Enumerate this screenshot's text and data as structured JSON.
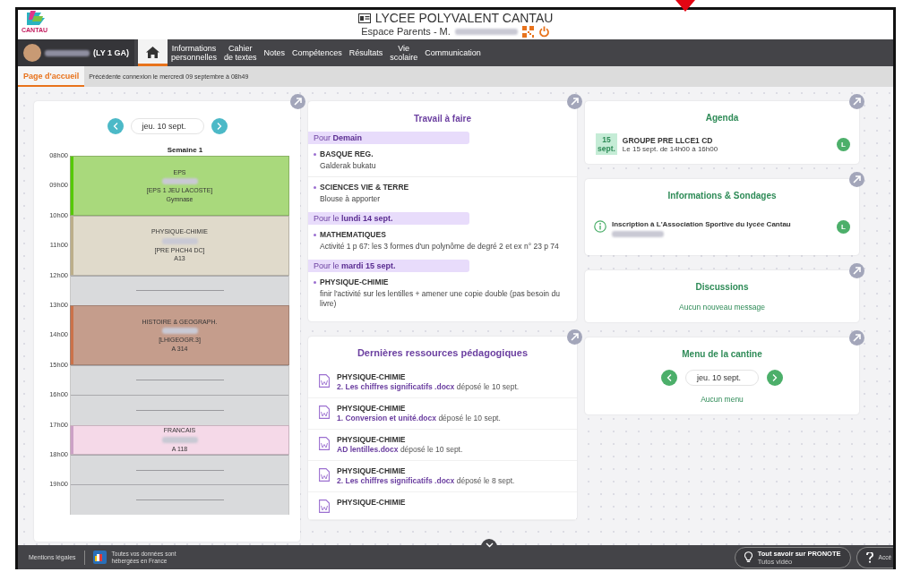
{
  "header": {
    "logo_text": "CANTAU",
    "school": "LYCEE POLYVALENT CANTAU",
    "space": "Espace Parents - M."
  },
  "nav": {
    "student_class": "(LY 1 GA)",
    "items": [
      {
        "kind": "home",
        "selected": true
      },
      {
        "kind": "text",
        "label": "Informations\npersonnelles",
        "selected": false
      },
      {
        "kind": "text",
        "label": "Cahier\nde textes",
        "selected": false
      },
      {
        "kind": "text",
        "label": "Notes",
        "selected": false
      },
      {
        "kind": "text",
        "label": "Compétences",
        "selected": false
      },
      {
        "kind": "text",
        "label": "Résultats",
        "selected": false
      },
      {
        "kind": "text",
        "label": "Vie\nscolaire",
        "selected": false
      },
      {
        "kind": "text",
        "label": "Communication",
        "selected": false
      }
    ]
  },
  "subbar": {
    "tabs": [
      {
        "label": "Page d'accueil",
        "selected": true
      }
    ],
    "last_login": "Précédente connexion le mercredi 09 septembre à 08h49"
  },
  "timetable": {
    "date": "jeu. 10 sept.",
    "week": "Semaine 1",
    "slots": [
      {
        "kind": "lesson",
        "hours": [
          "08h00",
          "09h00"
        ],
        "color": "#a9d97c",
        "subject": "EPS",
        "group": "[EPS 1 JEU LACOSTE]",
        "room": "Gymnase"
      },
      {
        "kind": "lesson",
        "hours": [
          "10h00",
          "11h00"
        ],
        "color": "#e0dacb",
        "subject": "PHYSIQUE-CHIMIE",
        "group": "[PRE PHCH4 DC]",
        "room": "A13"
      },
      {
        "kind": "free",
        "hours": [
          "12h00"
        ]
      },
      {
        "kind": "lesson",
        "hours": [
          "13h00",
          "14h00"
        ],
        "color": "#c59d8c",
        "subject": "HISTOIRE & GEOGRAPH.",
        "group": "[LHIGEOGR.3]",
        "room": "A 314"
      },
      {
        "kind": "free",
        "hours": [
          "15h00",
          "16h00"
        ]
      },
      {
        "kind": "lesson",
        "hours": [
          "17h00"
        ],
        "color": "#f5d9e8",
        "subject": "FRANCAIS",
        "room": "A 118"
      },
      {
        "kind": "free",
        "hours": [
          "18h00",
          "19h00"
        ]
      }
    ]
  },
  "homework": {
    "title": "Travail à faire",
    "groups": [
      {
        "heading": "Pour **Demain**",
        "items": [
          {
            "subject": "BASQUE REG.",
            "text": "Galderak bukatu"
          },
          {
            "subject": "SCIENCES VIE & TERRE",
            "text": "Blouse à apporter"
          }
        ]
      },
      {
        "heading": "Pour le **lundi 14 sept.**",
        "items": [
          {
            "subject": "MATHEMATIQUES",
            "text": "Activité 1 p 67: les 3 formes d'un polynôme de degré 2 et ex n° 23 p 74"
          }
        ]
      },
      {
        "heading": "Pour le **mardi 15 sept.**",
        "items": [
          {
            "subject": "PHYSIQUE-CHIMIE",
            "text": "finir l'activité sur les lentilles + amener une copie double (pas besoin du livre)"
          }
        ]
      }
    ]
  },
  "resources": {
    "title": "Dernières ressources pédagogiques",
    "items": [
      {
        "subject": "PHYSIQUE-CHIMIE",
        "file": "2. Les chiffres significatifs .docx",
        "date": "déposé le 10 sept."
      },
      {
        "subject": "PHYSIQUE-CHIMIE",
        "file": "1. Conversion et unité.docx",
        "date": "déposé le 10 sept."
      },
      {
        "subject": "PHYSIQUE-CHIMIE",
        "file": "AD lentilles.docx",
        "date": "déposé le 10 sept."
      },
      {
        "subject": "PHYSIQUE-CHIMIE",
        "file": "2. Les chiffres significatifs .docx",
        "date": "déposé le 8 sept."
      },
      {
        "subject": "PHYSIQUE-CHIMIE"
      }
    ]
  },
  "agenda": {
    "title": "Agenda",
    "events": [
      {
        "day": "15",
        "month": "sept.",
        "title": "GROUPE PRE LLCE1 CD",
        "time": "Le 15 sept. de 14h00 à 16h00",
        "badge": "L"
      }
    ]
  },
  "info": {
    "title": "Informations & Sondages",
    "items": [
      {
        "title": "Inscription à L'Association Sportive du lycée Cantau",
        "badge": "L"
      }
    ]
  },
  "discussions": {
    "title": "Discussions",
    "empty": "Aucun nouveau message"
  },
  "canteen": {
    "title": "Menu de la cantine",
    "date": "jeu. 10 sept.",
    "empty": "Aucun menu"
  },
  "footer": {
    "legal": "Mentions légales",
    "hosting": "Toutes vos données sont\nhébergées en France",
    "help_title": "Tout savoir sur PRONOTE",
    "help_subtitle": "Tutos vidéo",
    "access": "Accé"
  }
}
